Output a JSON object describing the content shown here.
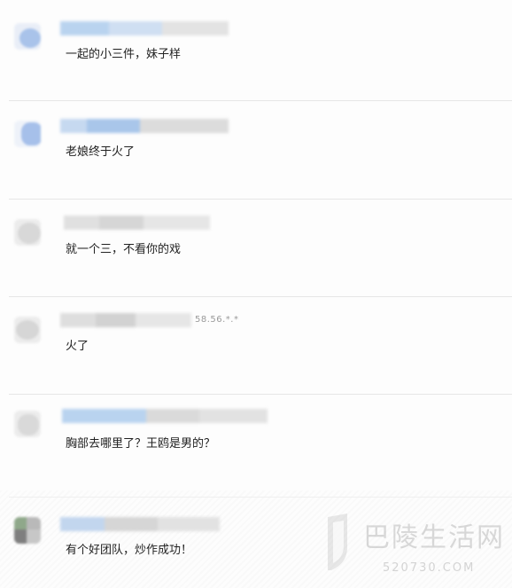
{
  "comments": [
    {
      "text": "一起的小三件，妹子样",
      "meta": ""
    },
    {
      "text": "老娘终于火了",
      "meta": ""
    },
    {
      "text": "就一个三，不看你的戏",
      "meta": ""
    },
    {
      "text": "火了",
      "meta": "58.56.*.*"
    },
    {
      "text": "胸部去哪里了？王鸥是男的？",
      "meta": ""
    },
    {
      "text": "有个好团队，炒作成功！",
      "meta": ""
    }
  ],
  "watermark": {
    "title": "巴陵生活网",
    "url": "520730.COM"
  },
  "colors": {
    "avatar_blue": "#a9c3ea",
    "avatar_grey": "#d5d5d5",
    "avatar_green": "#7f9a7a",
    "username_blue": "#b9d3ef",
    "username_grey": "#d9d9d9"
  }
}
